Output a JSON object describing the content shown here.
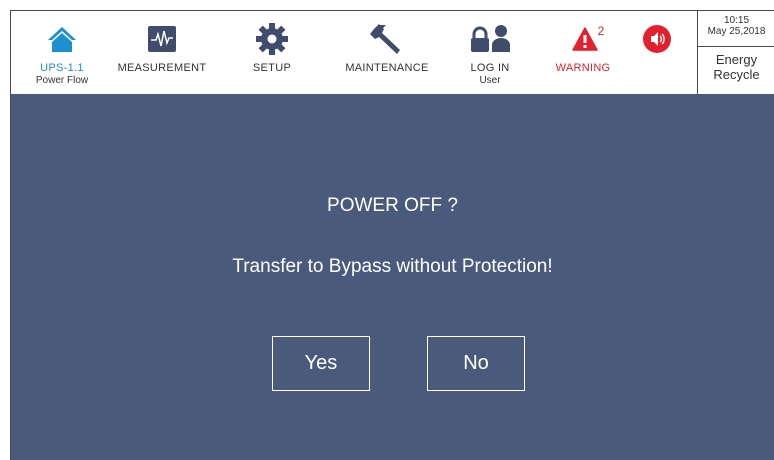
{
  "nav": {
    "home": {
      "label": "UPS-1.1",
      "sub": "Power Flow"
    },
    "measurement": {
      "label": "MEASUREMENT"
    },
    "setup": {
      "label": "SETUP"
    },
    "maintenance": {
      "label": "MAINTENANCE"
    },
    "login": {
      "label": "LOG IN",
      "sub": "User"
    },
    "warning": {
      "label": "WARNING",
      "count": "2"
    }
  },
  "status": {
    "time": "10:15",
    "date": "May 25,2018",
    "mode_line1": "Energy",
    "mode_line2": "Recycle"
  },
  "dialog": {
    "title": "POWER OFF ?",
    "message": "Transfer to Bypass without Protection!",
    "yes_label": "Yes",
    "no_label": "No"
  },
  "colors": {
    "accent": "#1e8fcf",
    "warning": "#e5202e",
    "dialog_bg": "#4a5a7d",
    "icon_dark": "#3f4c6b"
  },
  "icons": [
    "home-icon",
    "measurement-icon",
    "gear-icon",
    "wrench-icon",
    "lock-user-icon",
    "warning-icon",
    "speaker-icon"
  ]
}
